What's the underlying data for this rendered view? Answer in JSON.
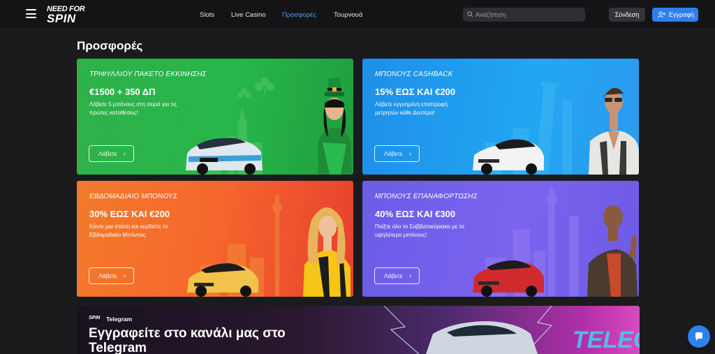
{
  "header": {
    "logo_line1": "NEED FOR",
    "logo_line2": "SPIN",
    "nav": [
      {
        "label": "Slots",
        "active": false
      },
      {
        "label": "Live Casino",
        "active": false
      },
      {
        "label": "Προσφορές",
        "active": true
      },
      {
        "label": "Τουρνουά",
        "active": false
      }
    ],
    "search_placeholder": "Αναζήτηση",
    "login_label": "Σύνδεση",
    "register_label": "Εγγραφή"
  },
  "page_title": "Προσφορές",
  "promos": [
    {
      "category": "ΤΡΙΦΥΛΛΙΟΥ ΠΑΚΕΤΟ ΕΚΚΙΝΗΣΗΣ",
      "amount": "€1500 + 350 ΔΠ",
      "description": "Λάβετε 5 μπόνους στη σειρά για τις πρώτες καταθέσεις!",
      "cta": "Λάβετε",
      "color": "#2fb14a"
    },
    {
      "category": "ΜΠΟΝΟΥΣ CASHBACK",
      "amount": "15% ΕΩΣ ΚΑΙ €200",
      "description": "Λάβετε εγγυημένη επιστροφή μετρητών κάθε Δευτέρα!",
      "cta": "Λάβετε",
      "color": "#22a6f2"
    },
    {
      "category": "ΕΒΔΟΜΑΔΙΑΙΟ ΜΠΟΝΟΥΣ",
      "amount": "30% ΕΩΣ ΚΑΙ €200",
      "description": "Κάντε μια στάση και κερδίστε το Εβδομαδιαίο Μπόνους",
      "cta": "Λάβετε",
      "color": "#f5662c"
    },
    {
      "category": "ΜΠΟΝΟΥΣ ΕΠΑΝΑΦΟΡΤΩΣΗΣ",
      "amount": "40% ΕΩΣ ΚΑΙ €300",
      "description": "Παίξτε όλο το Σαββατοκύριακο με το υψηλότερο μπόνους!",
      "cta": "Λάβετε",
      "color": "#7b63ee"
    }
  ],
  "telegram_banner": {
    "brand": "SPIN",
    "label": "Telegram",
    "headline": "Εγγραφείτε στο κανάλι μας στο Telegram",
    "art_text": "TELEGRA"
  }
}
